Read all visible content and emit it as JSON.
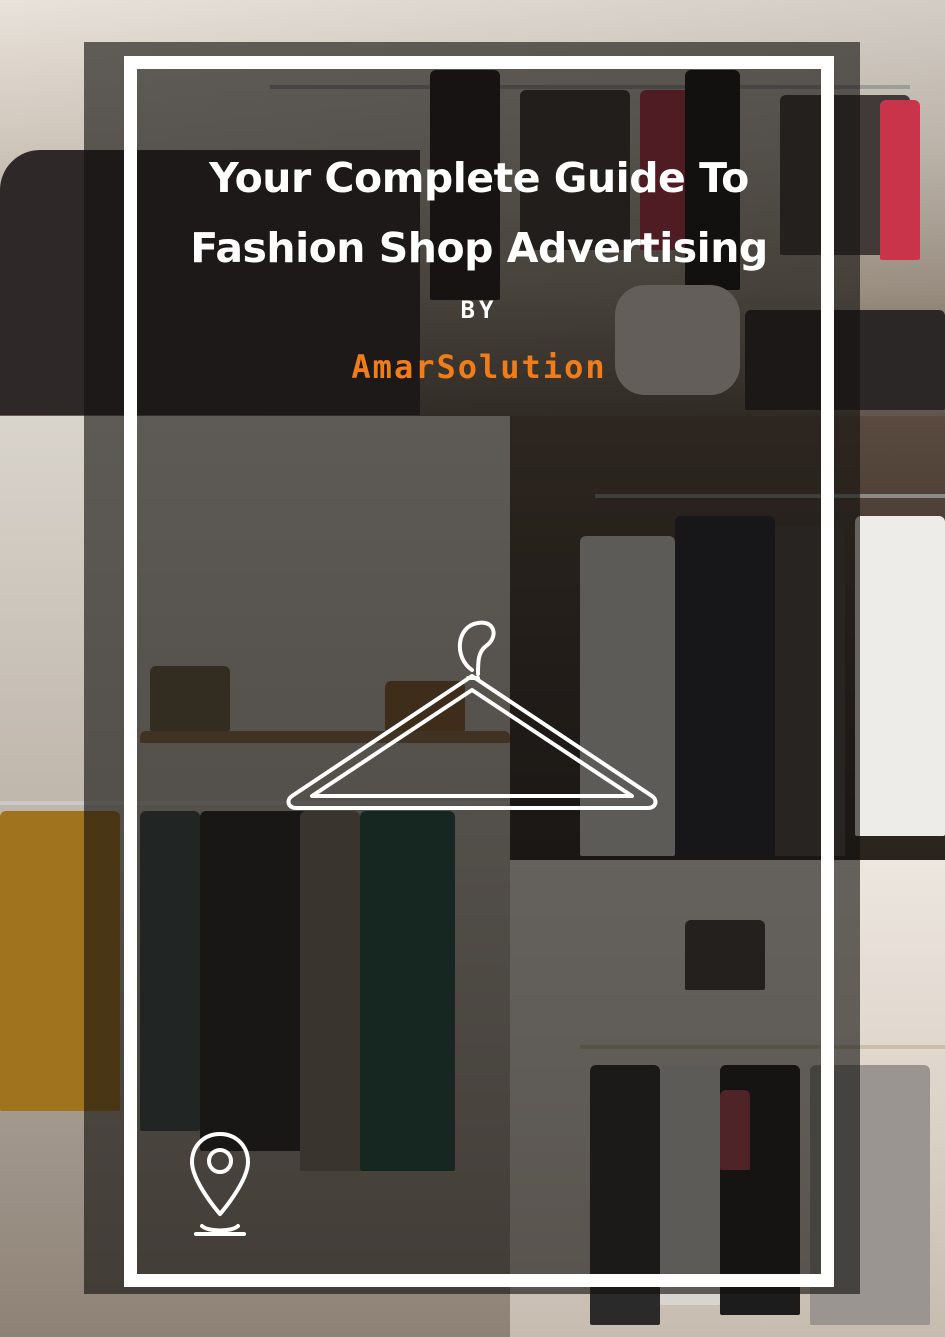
{
  "cover": {
    "title_line1": "Your Complete Guide To",
    "title_line2": "Fashion Shop Advertising",
    "by_label": "BY",
    "brand_name": "AmarSolution"
  },
  "icons": {
    "hanger": "hanger-icon",
    "location": "location-pin-icon"
  },
  "colors": {
    "brand": "#f07d1a",
    "frame": "#ffffff",
    "title": "#ffffff"
  }
}
